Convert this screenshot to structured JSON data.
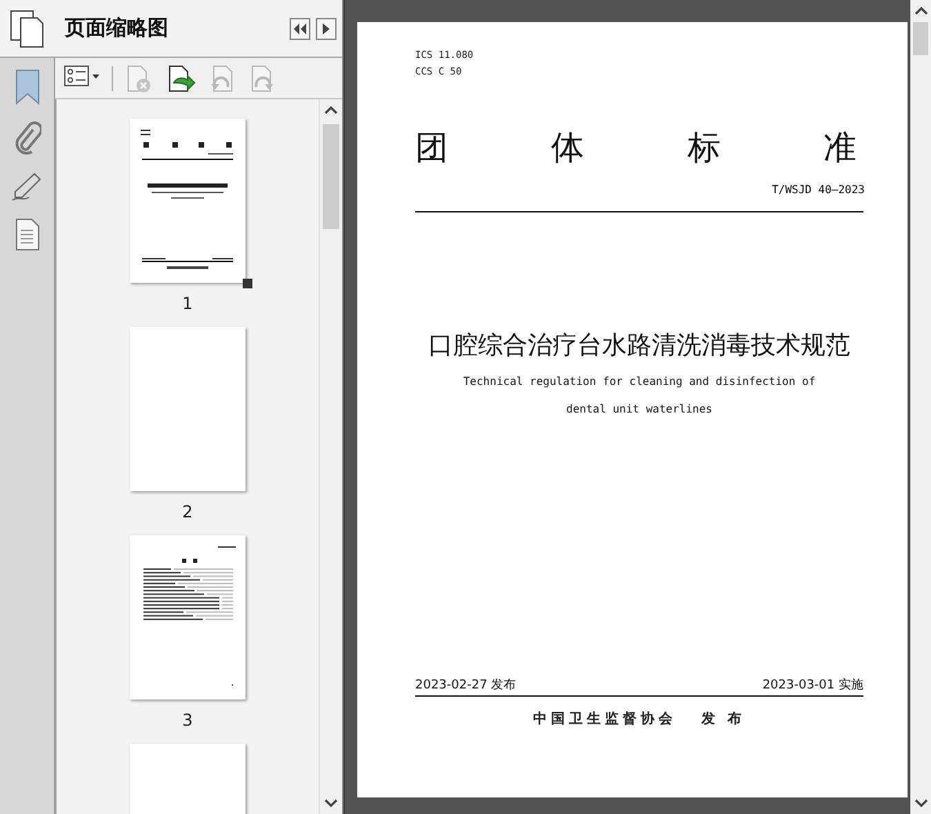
{
  "panel": {
    "title": "页面缩略图"
  },
  "toolbar": [
    {
      "kind": "options",
      "disabled": false
    },
    {
      "kind": "delete",
      "disabled": true
    },
    {
      "kind": "insert",
      "disabled": false
    },
    {
      "kind": "rotate-left",
      "disabled": true
    },
    {
      "kind": "rotate-right",
      "disabled": true
    }
  ],
  "thumbnails": [
    {
      "label": "1",
      "kind": "cover",
      "selected": true
    },
    {
      "label": "2",
      "kind": "blank",
      "selected": false
    },
    {
      "label": "3",
      "kind": "contents",
      "selected": false
    },
    {
      "kind": "blank",
      "selected": false
    }
  ],
  "document": {
    "codes": [
      "ICS 11.080",
      "CCS C 50"
    ],
    "heading": "团体标准",
    "number": "T/WSJD 40—2023",
    "title": "口腔综合治疗台水路清洗消毒技术规范",
    "subtitle": [
      "Technical regulation for cleaning and disinfection of",
      "dental unit waterlines"
    ],
    "issued": "2023-02-27 发布",
    "effective": "2023-03-01 实施",
    "publisher": "中国卫生监督协会",
    "publisher_action": "发 布"
  }
}
